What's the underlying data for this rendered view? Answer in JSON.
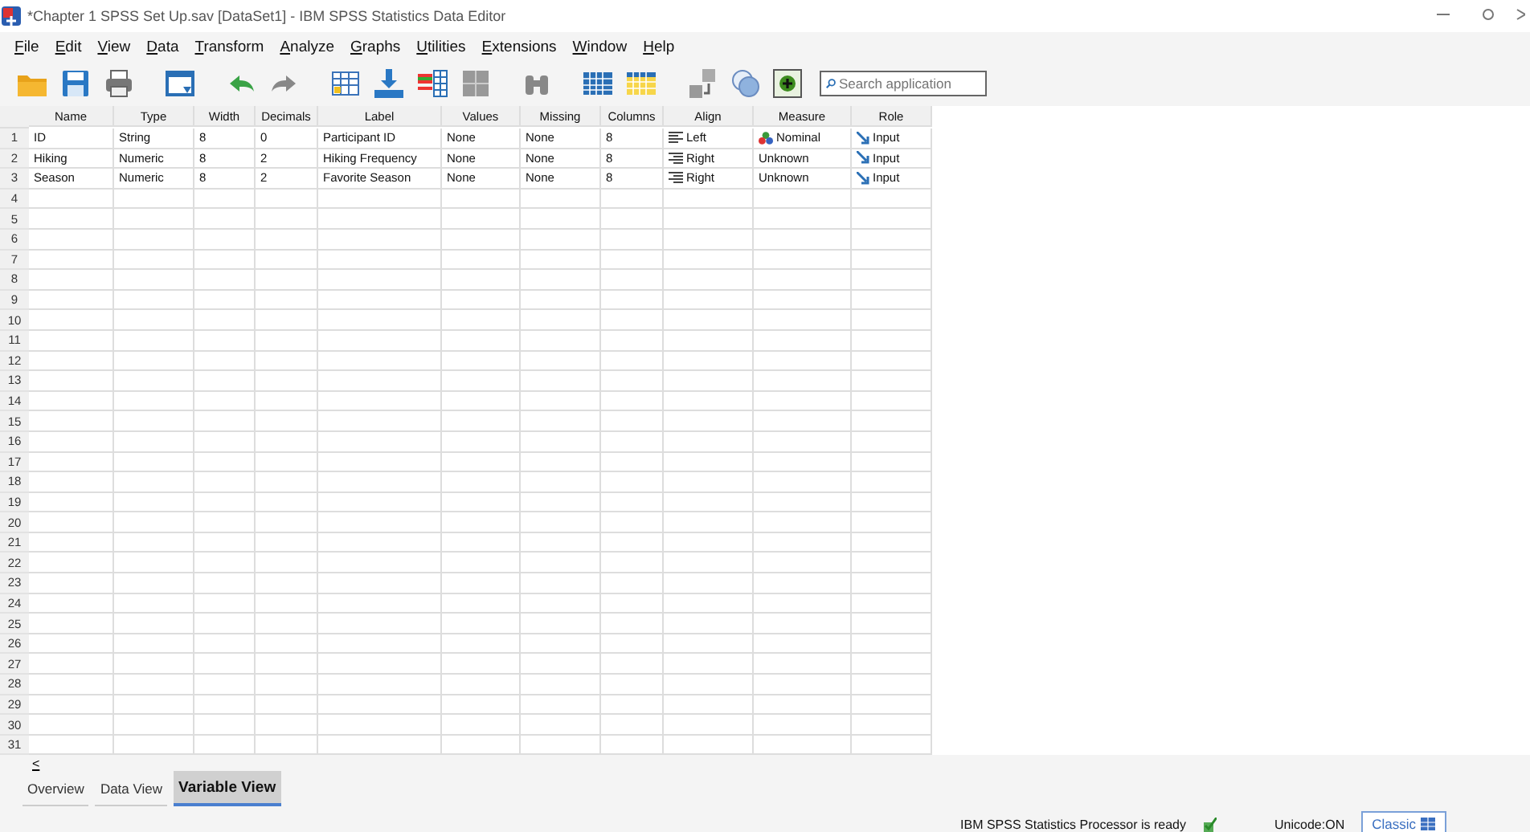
{
  "window": {
    "title": "*Chapter 1 SPSS Set Up.sav [DataSet1] - IBM SPSS Statistics Data Editor"
  },
  "menu": [
    "File",
    "Edit",
    "View",
    "Data",
    "Transform",
    "Analyze",
    "Graphs",
    "Utilities",
    "Extensions",
    "Window",
    "Help"
  ],
  "toolbar": {
    "search": {
      "placeholder": "Search application"
    }
  },
  "table": {
    "columns": [
      "Name",
      "Type",
      "Width",
      "Decimals",
      "Label",
      "Values",
      "Missing",
      "Columns",
      "Align",
      "Measure",
      "Role"
    ],
    "rows": [
      {
        "number": "1",
        "cells": [
          "ID",
          "String",
          "8",
          "0",
          "Participant ID",
          "None",
          "None",
          "8"
        ],
        "align": {
          "kind": "left",
          "text": "Left"
        },
        "measure": {
          "kind": "nominal",
          "text": "Nominal"
        },
        "role": {
          "kind": "input",
          "text": "Input"
        }
      },
      {
        "number": "2",
        "cells": [
          "Hiking",
          "Numeric",
          "8",
          "2",
          "Hiking Frequency",
          "None",
          "None",
          "8"
        ],
        "align": {
          "kind": "right",
          "text": "Right"
        },
        "measure": {
          "kind": "unknown",
          "text": "Unknown"
        },
        "role": {
          "kind": "input",
          "text": "Input"
        }
      },
      {
        "number": "3",
        "cells": [
          "Season",
          "Numeric",
          "8",
          "2",
          "Favorite Season",
          "None",
          "None",
          "8"
        ],
        "align": {
          "kind": "right",
          "text": "Right"
        },
        "measure": {
          "kind": "unknown",
          "text": "Unknown"
        },
        "role": {
          "kind": "input",
          "text": "Input"
        }
      },
      {
        "number": "4"
      },
      {
        "number": "5"
      },
      {
        "number": "6"
      },
      {
        "number": "7"
      },
      {
        "number": "8"
      },
      {
        "number": "9"
      },
      {
        "number": "10"
      },
      {
        "number": "11"
      },
      {
        "number": "12"
      },
      {
        "number": "13"
      },
      {
        "number": "14"
      },
      {
        "number": "15"
      },
      {
        "number": "16"
      },
      {
        "number": "17"
      },
      {
        "number": "18"
      },
      {
        "number": "19"
      },
      {
        "number": "20"
      },
      {
        "number": "21"
      },
      {
        "number": "22"
      },
      {
        "number": "23"
      },
      {
        "number": "24"
      },
      {
        "number": "25"
      },
      {
        "number": "26"
      },
      {
        "number": "27"
      },
      {
        "number": "28"
      },
      {
        "number": "29"
      },
      {
        "number": "30"
      },
      {
        "number": "31"
      }
    ]
  },
  "scroll_left": "<",
  "tabs": [
    {
      "label": "Overview",
      "selected": false
    },
    {
      "label": "Data View",
      "selected": false
    },
    {
      "label": "Variable View",
      "selected": true
    }
  ],
  "status_bar": {
    "processor": "IBM SPSS Statistics Processor is ready",
    "unicode": "Unicode:ON",
    "mode": "Classic"
  }
}
